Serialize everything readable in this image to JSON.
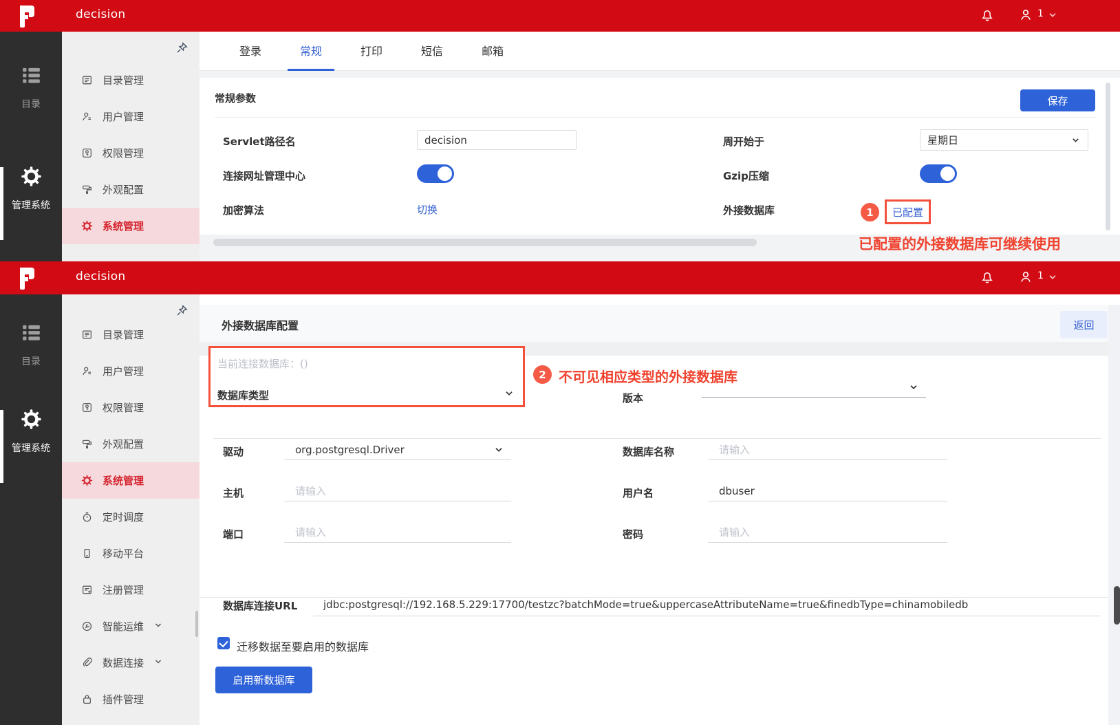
{
  "app": {
    "title": "decision",
    "user_badge": "1"
  },
  "colors": {
    "header_red": "#d20a13",
    "accent_blue": "#2e62d9",
    "link_blue": "#3561d2",
    "annotation_red": "#f0432f",
    "active_item_red": "#d5232e",
    "active_item_bg": "#f5d9dc"
  },
  "rail": {
    "items": [
      {
        "label": "目录",
        "icon": "catalog-group"
      },
      {
        "label": "管理系统",
        "icon": "gear",
        "active": true
      }
    ]
  },
  "subnav_top": {
    "items": [
      {
        "label": "目录管理",
        "icon": "catalog"
      },
      {
        "label": "用户管理",
        "icon": "user"
      },
      {
        "label": "权限管理",
        "icon": "key"
      },
      {
        "label": "外观配置",
        "icon": "paint"
      },
      {
        "label": "系统管理",
        "icon": "gear",
        "active": true
      }
    ]
  },
  "subnav_bottom": {
    "items": [
      {
        "label": "目录管理",
        "icon": "catalog"
      },
      {
        "label": "用户管理",
        "icon": "user"
      },
      {
        "label": "权限管理",
        "icon": "key"
      },
      {
        "label": "外观配置",
        "icon": "paint"
      },
      {
        "label": "系统管理",
        "icon": "gear",
        "active": true
      },
      {
        "label": "定时调度",
        "icon": "timer"
      },
      {
        "label": "移动平台",
        "icon": "mobile"
      },
      {
        "label": "注册管理",
        "icon": "register"
      },
      {
        "label": "智能运维",
        "icon": "ops",
        "chevron": true
      },
      {
        "label": "数据连接",
        "icon": "link",
        "chevron": true
      },
      {
        "label": "插件管理",
        "icon": "plugin"
      }
    ]
  },
  "screen1": {
    "tabs": [
      {
        "label": "登录"
      },
      {
        "label": "常规",
        "active": true
      },
      {
        "label": "打印"
      },
      {
        "label": "短信"
      },
      {
        "label": "邮箱"
      }
    ],
    "section_title": "常规参数",
    "save_label": "保存",
    "servlet_label": "Servlet路径名",
    "servlet_value": "decision",
    "week_label": "周开始于",
    "week_value": "星期日",
    "url_center_label": "连接网址管理中心",
    "gzip_label": "Gzip压缩",
    "encrypt_label": "加密算法",
    "switch_link": "切换",
    "extdb_label": "外接数据库",
    "extdb_status": "已配置",
    "annotation_number": "1",
    "annotation_note": "已配置的外接数据库可继续使用"
  },
  "screen2": {
    "page_title": "外接数据库配置",
    "back_label": "返回",
    "current_db": "当前连接数据库：()",
    "db_type_label": "数据库类型",
    "version_label": "版本",
    "annotation_number": "2",
    "annotation_note": "不可见相应类型的外接数据库",
    "form": {
      "driver_label": "驱动",
      "driver_value": "org.postgresql.Driver",
      "host_label": "主机",
      "host_placeholder": "请输入",
      "port_label": "端口",
      "port_placeholder": "请输入",
      "dbname_label": "数据库名称",
      "dbname_placeholder": "请输入",
      "user_label": "用户名",
      "user_value": "dbuser",
      "password_label": "密码",
      "password_placeholder": "请输入",
      "url_label": "数据库连接URL",
      "url_value": "jdbc:postgresql://192.168.5.229:17700/testzc?batchMode=true&uppercaseAttributeName=true&finedbType=chinamobiledb",
      "migrate_label": "迁移数据至要启用的数据库",
      "enable_button": "启用新数据库"
    }
  }
}
